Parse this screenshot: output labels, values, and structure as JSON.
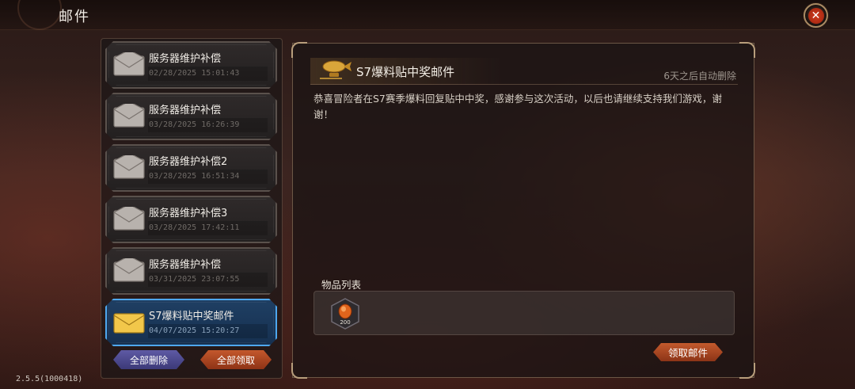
{
  "header": {
    "title": "邮件"
  },
  "mail_list": {
    "items": [
      {
        "name": "服务器维护补偿",
        "date": "02/28/2025 15:01:43",
        "selected": false
      },
      {
        "name": "服务器维护补偿",
        "date": "03/28/2025 16:26:39",
        "selected": false
      },
      {
        "name": "服务器维护补偿2",
        "date": "03/28/2025 16:51:34",
        "selected": false
      },
      {
        "name": "服务器维护补偿3",
        "date": "03/28/2025 17:42:11",
        "selected": false
      },
      {
        "name": "服务器维护补偿",
        "date": "03/31/2025 23:07:55",
        "selected": false
      },
      {
        "name": "S7爆料贴中奖邮件",
        "date": "04/07/2025 15:20:27",
        "selected": true
      }
    ],
    "delete_all_label": "全部删除",
    "claim_all_label": "全部领取"
  },
  "detail": {
    "title": "S7爆料贴中奖邮件",
    "auto_delete": "6天之后自动删除",
    "body": "恭喜冒险者在S7赛季爆料回复贴中中奖，感谢参与这次活动，以后也请继续支持我们游戏，谢谢！",
    "items_label": "物品列表",
    "items": [
      {
        "icon": "orange-gem-icon",
        "count": "200"
      }
    ],
    "claim_label": "领取邮件"
  },
  "footer": {
    "version": "2.5.5(1000418)"
  },
  "colors": {
    "selected_border": "#4ea7ee",
    "claim_button": "#c35a2d",
    "delete_button": "#5e5aa4",
    "close_accent": "#d03a1c"
  }
}
